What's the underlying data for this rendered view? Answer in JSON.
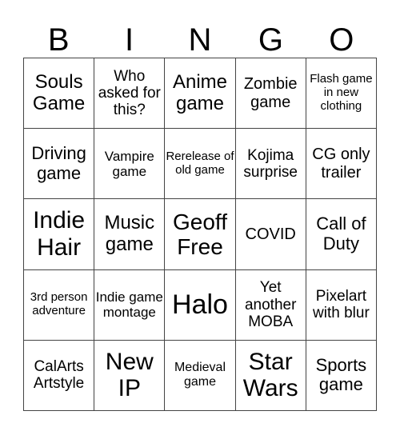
{
  "header": [
    "B",
    "I",
    "N",
    "G",
    "O"
  ],
  "cells": [
    [
      "Souls Game",
      "Who asked for this?",
      "Anime game",
      "Zombie game",
      "Flash game in new clothing"
    ],
    [
      "Driving game",
      "Vampire game",
      "Rerelease of old game",
      "Kojima surprise",
      "CG only trailer"
    ],
    [
      "Indie Hair",
      "Music game",
      "Geoff Free",
      "COVID",
      "Call of Duty"
    ],
    [
      "3rd person adventure",
      "Indie game montage",
      "Halo",
      "Yet another MOBA",
      "Pixelart with blur"
    ],
    [
      "CalArts Artstyle",
      "New IP",
      "Medieval game",
      "Star Wars",
      "Sports game"
    ]
  ]
}
